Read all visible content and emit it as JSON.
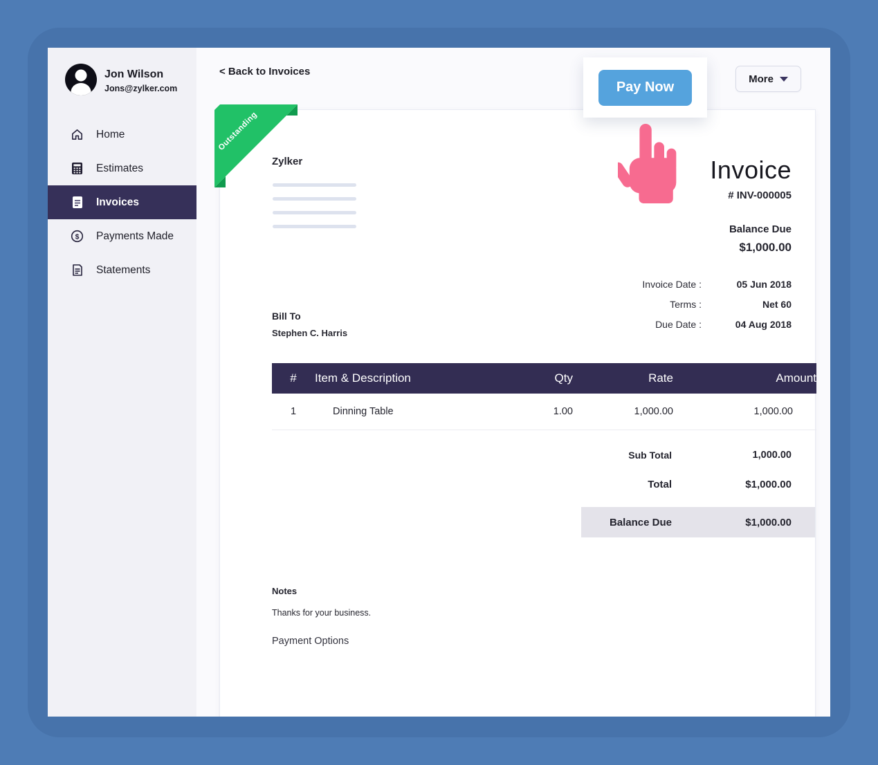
{
  "colors": {
    "page_bg": "#4e7cb5",
    "sidebar_bg": "#f1f1f6",
    "accent_purple": "#363059",
    "table_header": "#332d53",
    "ribbon_green": "#21c167",
    "ribbon_fold_green": "#109b4e",
    "paynow_blue": "#55a3dd",
    "hand_pink": "#f76b90",
    "highlight_row": "#e4e3ea"
  },
  "sidebar": {
    "user": {
      "name": "Jon Wilson",
      "email": "Jons@zylker.com"
    },
    "items": [
      {
        "label": "Home",
        "icon": "home-icon",
        "active": false
      },
      {
        "label": "Estimates",
        "icon": "calculator-icon",
        "active": false
      },
      {
        "label": "Invoices",
        "icon": "invoice-document-icon",
        "active": true
      },
      {
        "label": "Payments Made",
        "icon": "dollar-circle-icon",
        "active": false
      },
      {
        "label": "Statements",
        "icon": "statement-document-icon",
        "active": false
      }
    ]
  },
  "topbar": {
    "back_link": "< Back to Invoices",
    "pay_now_label": "Pay Now",
    "more_label": "More"
  },
  "invoice": {
    "status_ribbon": "Outstanding",
    "company": "Zylker",
    "title": "Invoice",
    "number": "# INV-000005",
    "balance": {
      "label": "Balance Due",
      "value": "$1,000.00"
    },
    "meta": [
      {
        "label": "Invoice Date :",
        "value": "05 Jun 2018"
      },
      {
        "label": "Terms :",
        "value": "Net 60"
      },
      {
        "label": "Due Date :",
        "value": "04 Aug 2018"
      }
    ],
    "bill_to": {
      "label": "Bill To",
      "name": "Stephen C. Harris"
    },
    "table": {
      "headers": [
        "#",
        "Item & Description",
        "Qty",
        "Rate",
        "Amount"
      ],
      "rows": [
        [
          "1",
          "Dinning Table",
          "1.00",
          "1,000.00",
          "1,000.00"
        ]
      ]
    },
    "totals": [
      {
        "label": "Sub Total",
        "value": "1,000.00"
      },
      {
        "label": "Total",
        "value": "$1,000.00"
      },
      {
        "label": "Balance Due",
        "value": "$1,000.00"
      }
    ],
    "notes": {
      "label": "Notes",
      "text": "Thanks for your business."
    },
    "payment_options_label": "Payment Options"
  }
}
